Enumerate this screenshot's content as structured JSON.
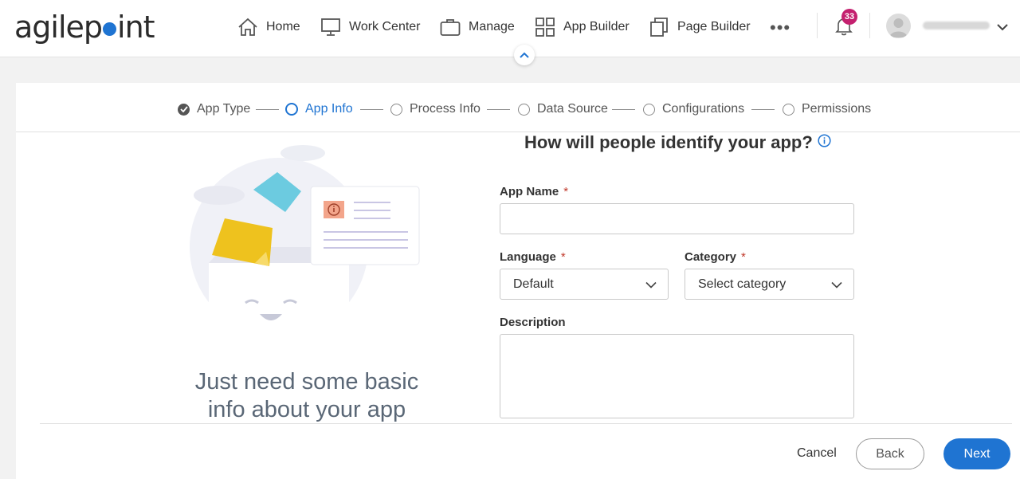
{
  "header": {
    "logo_left": "agilep",
    "logo_right": "int",
    "nav": [
      {
        "label": "Home",
        "icon": "home-icon"
      },
      {
        "label": "Work Center",
        "icon": "monitor-icon"
      },
      {
        "label": "Manage",
        "icon": "briefcase-icon"
      },
      {
        "label": "App Builder",
        "icon": "grid-icon"
      },
      {
        "label": "Page Builder",
        "icon": "pages-icon"
      }
    ],
    "more": "•••",
    "notifications_count": "33"
  },
  "stepper": {
    "steps": [
      {
        "label": "App Type",
        "state": "done"
      },
      {
        "label": "App Info",
        "state": "active"
      },
      {
        "label": "Process Info",
        "state": "pending"
      },
      {
        "label": "Data Source",
        "state": "pending"
      },
      {
        "label": "Configurations",
        "state": "pending"
      },
      {
        "label": "Permissions",
        "state": "pending"
      }
    ]
  },
  "illustration": {
    "tagline_line1": "Just need some basic",
    "tagline_line2": "info about your app"
  },
  "form": {
    "title": "How will people identify your app?",
    "app_name_label": "App Name",
    "app_name_value": "",
    "required_mark": "*",
    "language_label": "Language",
    "language_value": "Default",
    "category_label": "Category",
    "category_value": "Select category",
    "description_label": "Description",
    "description_value": ""
  },
  "footer": {
    "cancel": "Cancel",
    "back": "Back",
    "next": "Next"
  },
  "colors": {
    "accent": "#1f74d2",
    "badge": "#c4206f",
    "required": "#c0392b"
  }
}
